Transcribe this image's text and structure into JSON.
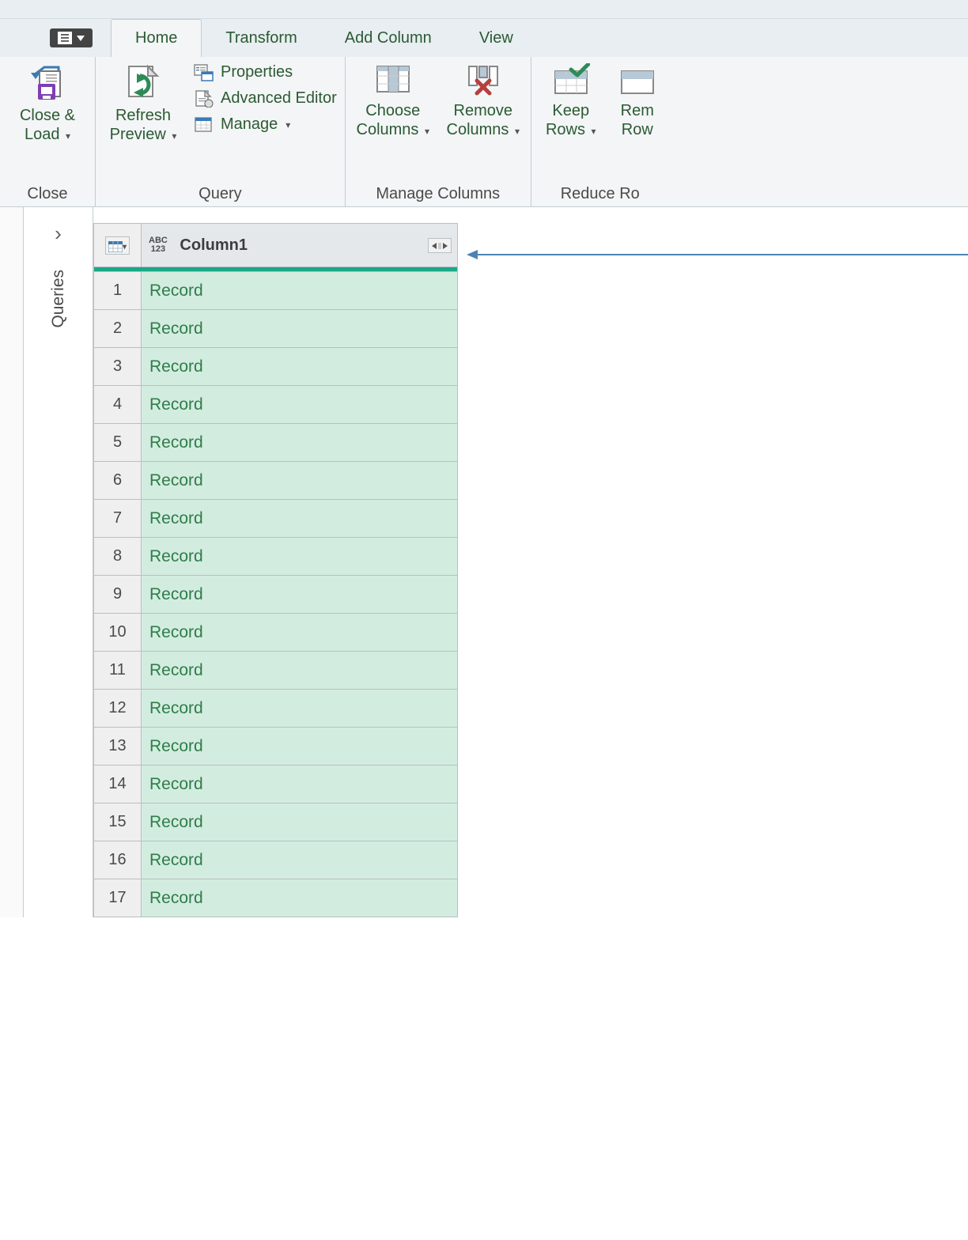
{
  "tabs": {
    "home": "Home",
    "transform": "Transform",
    "addColumn": "Add Column",
    "view": "View",
    "active": "home"
  },
  "ribbon": {
    "close": {
      "closeLoad": "Close &\nLoad",
      "groupLabel": "Close"
    },
    "query": {
      "refresh": "Refresh\nPreview",
      "properties": "Properties",
      "advanced": "Advanced Editor",
      "manage": "Manage",
      "groupLabel": "Query"
    },
    "manageColumns": {
      "choose": "Choose\nColumns",
      "remove": "Remove\nColumns",
      "groupLabel": "Manage Columns"
    },
    "reduceRows": {
      "keep": "Keep\nRows",
      "remove": "Rem\nRow",
      "groupLabel": "Reduce Ro"
    }
  },
  "sidebar": {
    "queries": "Queries"
  },
  "grid": {
    "columnHeader": "Column1",
    "typeLabelTop": "ABC",
    "typeLabelBottom": "123",
    "rows": [
      {
        "n": 1,
        "v": "Record"
      },
      {
        "n": 2,
        "v": "Record"
      },
      {
        "n": 3,
        "v": "Record"
      },
      {
        "n": 4,
        "v": "Record"
      },
      {
        "n": 5,
        "v": "Record"
      },
      {
        "n": 6,
        "v": "Record"
      },
      {
        "n": 7,
        "v": "Record"
      },
      {
        "n": 8,
        "v": "Record"
      },
      {
        "n": 9,
        "v": "Record"
      },
      {
        "n": 10,
        "v": "Record"
      },
      {
        "n": 11,
        "v": "Record"
      },
      {
        "n": 12,
        "v": "Record"
      },
      {
        "n": 13,
        "v": "Record"
      },
      {
        "n": 14,
        "v": "Record"
      },
      {
        "n": 15,
        "v": "Record"
      },
      {
        "n": 16,
        "v": "Record"
      },
      {
        "n": 17,
        "v": "Record"
      }
    ]
  }
}
